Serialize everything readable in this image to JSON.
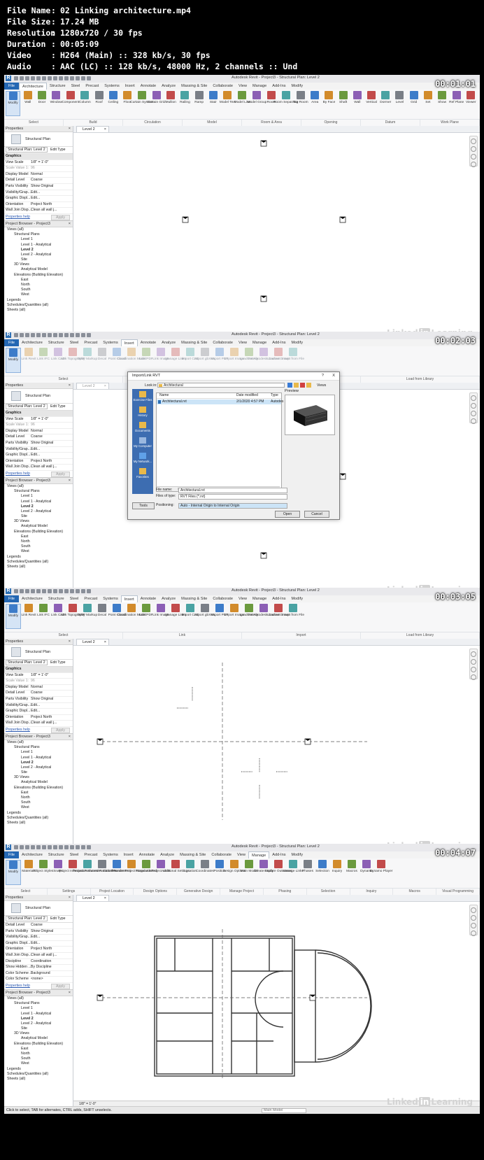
{
  "meta": {
    "rows": [
      {
        "k": "File Name",
        "v": "02 Linking architecture.mp4"
      },
      {
        "k": "File Size",
        "v": "17.24 MB"
      },
      {
        "k": "Resolution",
        "v": "1280x720 / 30 fps"
      },
      {
        "k": "Duration",
        "v": "00:05:09"
      },
      {
        "k": "Video",
        "v": "H264 (Main) :: 328 kb/s, 30 fps"
      },
      {
        "k": "Audio",
        "v": "AAC (LC) :: 128 kb/s, 48000 Hz, 2 channels :: Und"
      }
    ]
  },
  "common": {
    "title": "Autodesk Revit - Project3 - Structural Plan: Level 2",
    "tabs": [
      "File",
      "Architecture",
      "Structure",
      "Steel",
      "Precast",
      "Systems",
      "Insert",
      "Annotate",
      "Analyze",
      "Massing & Site",
      "Collaborate",
      "View",
      "Manage",
      "Add-Ins",
      "Modify"
    ],
    "properties_header": "Properties",
    "type_name": "Structural Plan",
    "filter_label": "Structural Plan: Level 2",
    "edit_type": "Edit Type",
    "properties_help": "Properties help",
    "apply": "Apply",
    "browser_header": "Project Browser - Project3",
    "view_tab": "Level 2",
    "scale": "1/8\" = 1'-0\"",
    "status_hint": "Click to select, TAB for alternates, CTRL adds, SHIFT unselects.",
    "status_ready": "Ready",
    "main_model": "Main Model",
    "watermark_a": "Linked",
    "watermark_b": "in",
    "watermark_c": "Learning"
  },
  "tree": [
    {
      "t": "Views (all)",
      "d": 0
    },
    {
      "t": "Structural Plans",
      "d": 1
    },
    {
      "t": "Level 1",
      "d": 2
    },
    {
      "t": "Level 1 - Analytical",
      "d": 2
    },
    {
      "t": "Level 2",
      "d": 2,
      "b": true
    },
    {
      "t": "Level 2 - Analytical",
      "d": 2
    },
    {
      "t": "Site",
      "d": 2
    },
    {
      "t": "3D Views",
      "d": 1
    },
    {
      "t": "Analytical Model",
      "d": 2
    },
    {
      "t": "Elevations (Building Elevation)",
      "d": 1
    },
    {
      "t": "East",
      "d": 2
    },
    {
      "t": "North",
      "d": 2
    },
    {
      "t": "South",
      "d": 2
    },
    {
      "t": "West",
      "d": 2
    },
    {
      "t": "Legends",
      "d": 0
    },
    {
      "t": "Schedules/Quantities (all)",
      "d": 0
    },
    {
      "t": "Sheets (all)",
      "d": 0
    }
  ],
  "props_a": [
    {
      "k": "Graphics",
      "v": "",
      "g": true
    },
    {
      "k": "View Scale",
      "v": "1/8\" = 1'-0\""
    },
    {
      "k": "Scale Value 1:",
      "v": "96",
      "gray": true
    },
    {
      "k": "Display Model",
      "v": "Normal"
    },
    {
      "k": "Detail Level",
      "v": "Coarse"
    },
    {
      "k": "Parts Visibility",
      "v": "Show Original"
    },
    {
      "k": "Visibility/Grap...",
      "v": "Edit..."
    },
    {
      "k": "Graphic Displ...",
      "v": "Edit..."
    },
    {
      "k": "Orientation",
      "v": "Project North"
    },
    {
      "k": "Wall Join Disp...",
      "v": "Clean all wall j..."
    }
  ],
  "props_b": [
    {
      "k": "Detail Level",
      "v": "Coarse"
    },
    {
      "k": "Parts Visibility",
      "v": "Show Original"
    },
    {
      "k": "Visibility/Grap...",
      "v": "Edit..."
    },
    {
      "k": "Graphic Displ...",
      "v": "Edit..."
    },
    {
      "k": "Orientation",
      "v": "Project North"
    },
    {
      "k": "Wall Join Disp...",
      "v": "Clean all wall j..."
    },
    {
      "k": "Discipline",
      "v": "Coordination"
    },
    {
      "k": "Show Hidden ...",
      "v": "By Discipline"
    },
    {
      "k": "Color Scheme ...",
      "v": "Background"
    },
    {
      "k": "Color Scheme",
      "v": "<none>"
    }
  ],
  "frames": [
    {
      "ts": "00:01:01",
      "active_tab": "Architecture",
      "tools": [
        "Modify",
        "Wall",
        "Door",
        "Window",
        "Component",
        "Column",
        "Roof",
        "Ceiling",
        "Floor",
        "Curtain System",
        "Curtain Grid",
        "Mullion",
        "Railing",
        "Ramp",
        "Stair",
        "Model Text",
        "Model Line",
        "Model Group",
        "Room",
        "Room Separator",
        "Tag Room",
        "Area",
        "By Face",
        "Shaft",
        "Wall",
        "Vertical",
        "Dormer",
        "Level",
        "Grid",
        "Set",
        "Show",
        "Ref Plane",
        "Viewer"
      ],
      "groups": [
        "Select",
        "Build",
        "Circulation",
        "Model",
        "Room & Area",
        "Opening",
        "Datum",
        "Work Plane"
      ],
      "status": "hint"
    },
    {
      "ts": "00:02:03",
      "active_tab": "Insert",
      "tools": [
        "Modify",
        "Link Revit",
        "Link IFC",
        "Link CAD",
        "Link Topography",
        "DWF Markup",
        "Decal",
        "Point Cloud",
        "Coordination Model",
        "Link PDF",
        "Link Image",
        "Manage Links",
        "Import CAD",
        "Import gbXML",
        "Import PDF",
        "Import Image",
        "Load Family",
        "Get Autodesk Content",
        "Load as Group",
        "Insert from File"
      ],
      "groups": [
        "Select",
        "Link",
        "Import",
        "Load from Library"
      ],
      "status": "ready"
    },
    {
      "ts": "00:03:05",
      "active_tab": "Insert",
      "tools": [
        "Modify",
        "Link Revit",
        "Link IFC",
        "Link CAD",
        "Link Topography",
        "DWF Markup",
        "Decal",
        "Point Cloud",
        "Coordination Model",
        "Link PDF",
        "Link Image",
        "Manage Links",
        "Import CAD",
        "Import gbXML",
        "Import PDF",
        "Import Image",
        "Load Family",
        "Get Autodesk Content",
        "Load as Group",
        "Insert from File"
      ],
      "groups": [
        "Select",
        "Link",
        "Import",
        "Load from Library"
      ],
      "status": "hint"
    },
    {
      "ts": "00:04:07",
      "active_tab": "Manage",
      "tools": [
        "Modify",
        "Materials",
        "Object Styles",
        "Snaps",
        "Project Information",
        "Project Parameters",
        "Shared Parameters",
        "Global Parameters",
        "Transfer Project Standards",
        "Purge Unused",
        "Project Units",
        "Additional Settings",
        "Location",
        "Coordinates",
        "Position",
        "Design Options",
        "Main Model",
        "Create Study",
        "Explore Outcomes",
        "Manage Links",
        "Phases",
        "Selection",
        "Inquiry",
        "Macros",
        "Dynamo",
        "Dynamo Player"
      ],
      "groups": [
        "Select",
        "Settings",
        "Project Location",
        "Design Options",
        "Generative Design",
        "Manage Project",
        "Phasing",
        "Selection",
        "Inquiry",
        "Macros",
        "Visual Programming"
      ],
      "status": "hint"
    }
  ],
  "dialog": {
    "title": "Import/Link RVT",
    "help": "?",
    "close": "X",
    "look_in_label": "Look in:",
    "look_in_value": "Architectural",
    "views_label": "Views",
    "col_name": "Name",
    "col_date": "Date modified",
    "col_type": "Type",
    "file_name": "Architectural.rvt",
    "file_date": "2/1/2020 4:57 PM",
    "file_type": "Autodes",
    "preview_label": "Preview",
    "places": [
      "Exercise Files",
      "History",
      "Documents",
      "My Computer",
      "My Network...",
      "Favorites"
    ],
    "fname_label": "File name:",
    "fname_value": "Architectural.rvt",
    "ftype_label": "Files of type:",
    "ftype_value": "RVT Files (*.rvt)",
    "positioning_label": "Positioning:",
    "positioning_value": "Auto - Internal Origin to Internal Origin",
    "tools_btn": "Tools",
    "open_btn": "Open",
    "cancel_btn": "Cancel"
  }
}
